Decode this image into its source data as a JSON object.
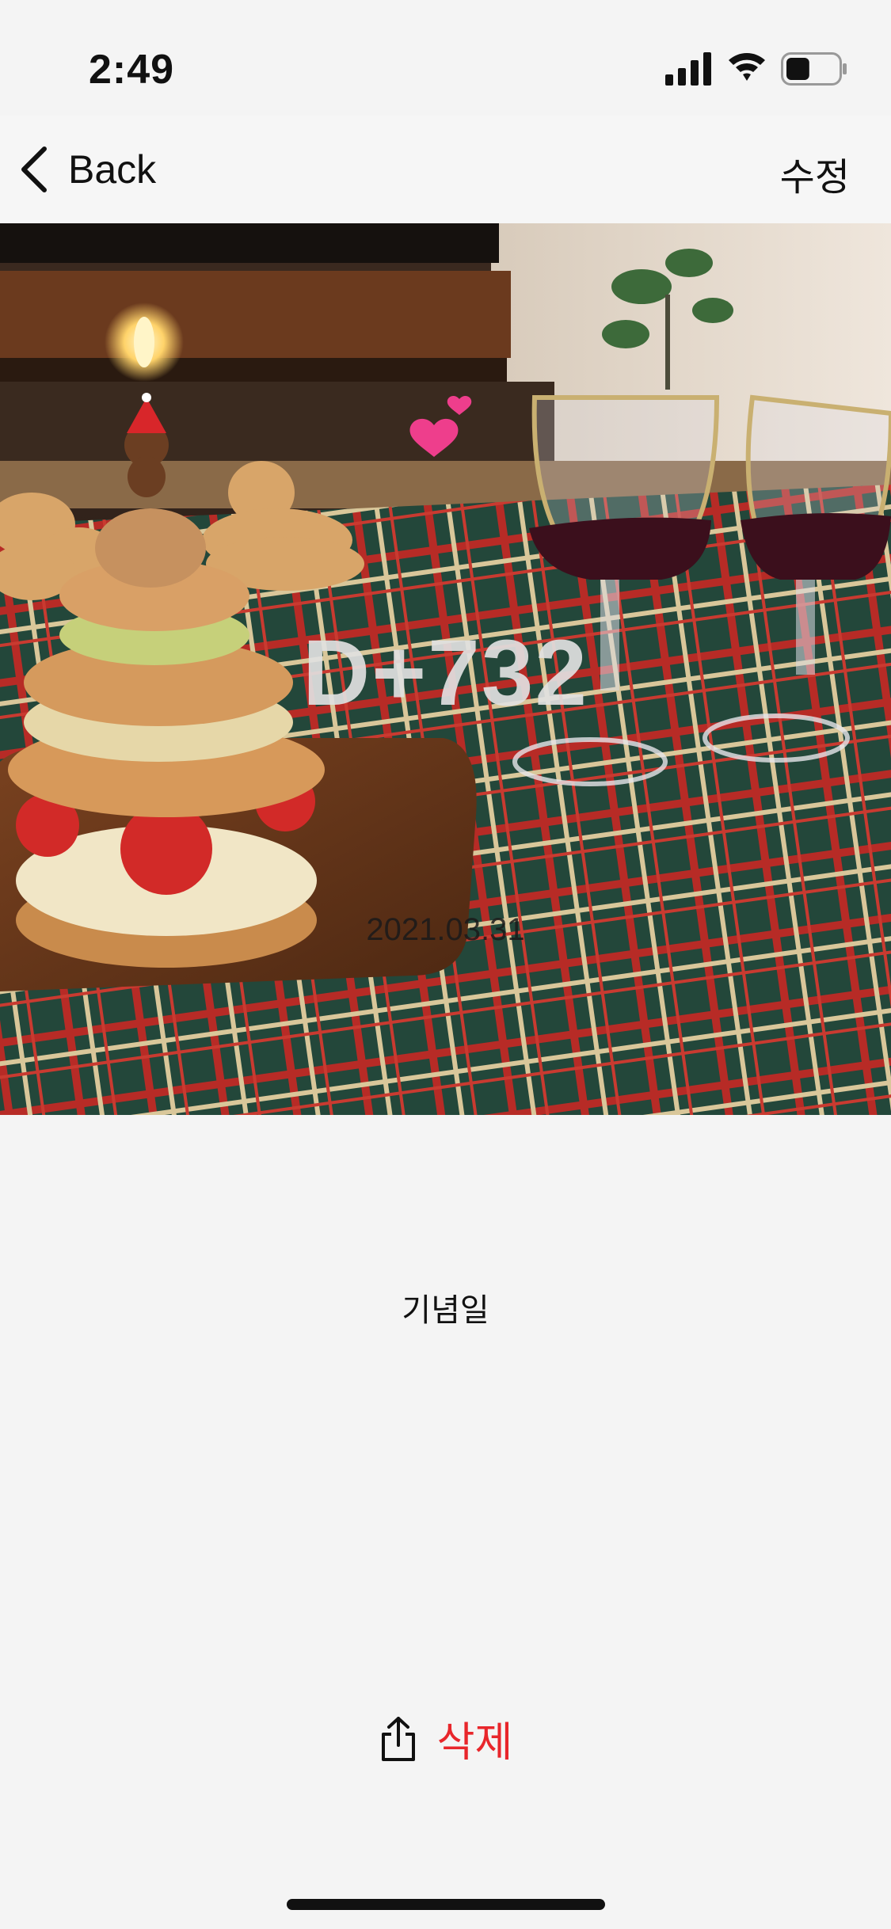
{
  "status_bar": {
    "time": "2:49",
    "icons": [
      "signal-icon",
      "wifi-icon",
      "battery-icon"
    ],
    "battery_level": 0.45
  },
  "nav": {
    "back_label": "Back",
    "back_icon": "chevron-left-icon",
    "edit_label": "수정"
  },
  "photo": {
    "dday": "D+732",
    "date": "2021.03.31"
  },
  "content": {
    "title": "기념일"
  },
  "actions": {
    "share_icon": "share-icon",
    "delete_label": "삭제",
    "delete_color": "#e8262b"
  }
}
